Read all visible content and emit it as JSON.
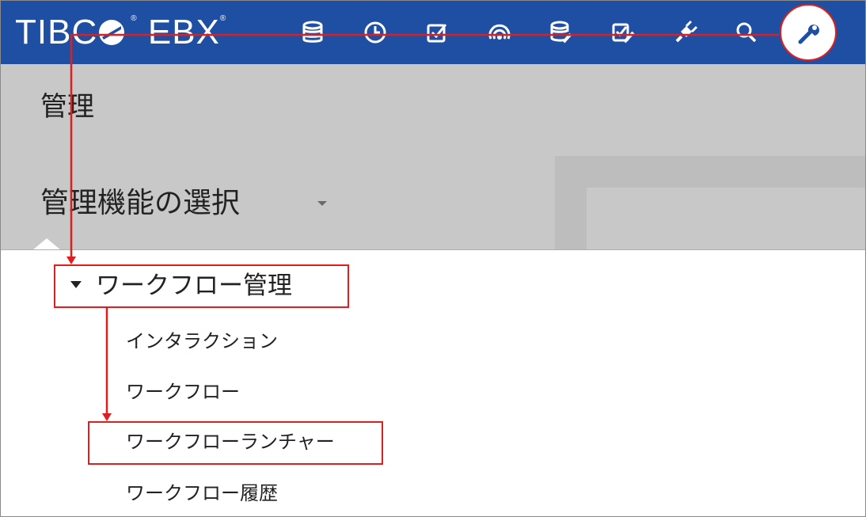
{
  "app": {
    "logo_left": "TIBC",
    "logo_right": "EBX",
    "registered_mark": "®",
    "brand_color": "#1e4fa3"
  },
  "toolbar": {
    "icons": [
      {
        "name": "data-icon"
      },
      {
        "name": "history-icon"
      },
      {
        "name": "tasks-icon"
      },
      {
        "name": "dataspace-icon"
      },
      {
        "name": "data-model-icon"
      },
      {
        "name": "workflow-model-icon"
      },
      {
        "name": "plugin-icon"
      },
      {
        "name": "search-icon"
      }
    ],
    "admin": {
      "name": "wrench-icon"
    }
  },
  "admin": {
    "title": "管理",
    "feature_selector": "管理機能の選択"
  },
  "menu": {
    "group": "ワークフロー管理",
    "items": [
      {
        "label": "インタラクション"
      },
      {
        "label": "ワークフロー"
      },
      {
        "label": "ワークフローランチャー"
      },
      {
        "label": "ワークフロー履歴"
      }
    ]
  },
  "annotation_color": "#e01e1e"
}
